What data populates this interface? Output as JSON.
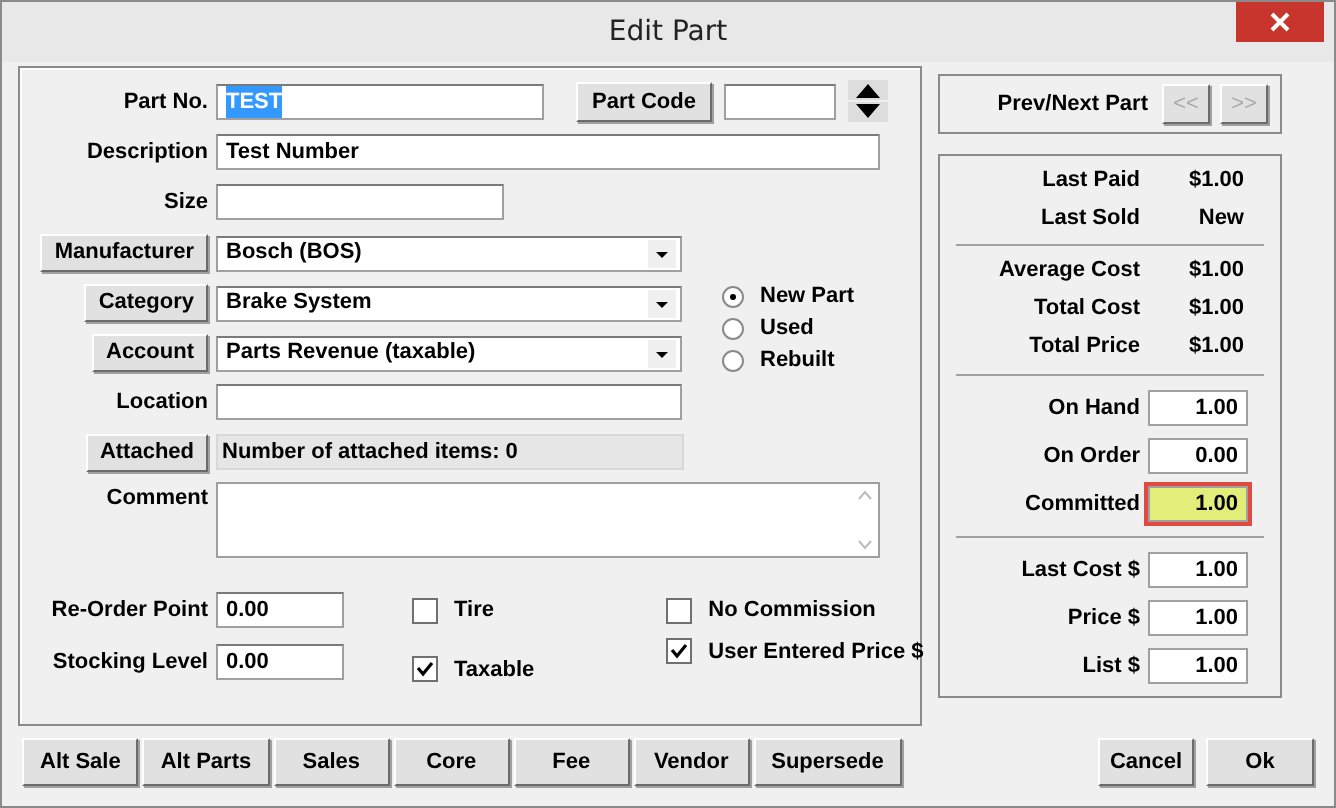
{
  "window": {
    "title": "Edit Part"
  },
  "part_no": {
    "label": "Part No.",
    "value": "TEST",
    "text_selected": true
  },
  "part_code": {
    "button": "Part Code"
  },
  "description": {
    "label": "Description",
    "value": "Test Number"
  },
  "size": {
    "label": "Size"
  },
  "dropdowns": [
    {
      "button": "Manufacturer",
      "value": "Bosch (BOS)"
    },
    {
      "button": "Category",
      "value": "Brake System"
    },
    {
      "button": "Account",
      "value": "Parts Revenue (taxable)"
    }
  ],
  "condition": [
    {
      "label": "New Part",
      "selected": true
    },
    {
      "label": "Used",
      "selected": false
    },
    {
      "label": "Rebuilt",
      "selected": false
    }
  ],
  "location": {
    "label": "Location"
  },
  "attached": {
    "button": "Attached",
    "text": "Number of attached items: 0"
  },
  "comment": {
    "label": "Comment"
  },
  "stock_fields": [
    {
      "label": "Re-Order Point",
      "value": "0.00"
    },
    {
      "label": "Stocking Level",
      "value": "0.00"
    }
  ],
  "flags_left": [
    {
      "label": "Tire",
      "checked": false
    },
    {
      "label": "Taxable",
      "checked": true
    }
  ],
  "flags_right": [
    {
      "label": "No Commission",
      "checked": false
    },
    {
      "label": "User Entered Price $",
      "checked": true
    }
  ],
  "prev_next": {
    "label": "Prev/Next Part",
    "prev": "<<",
    "next": ">>",
    "disabled": true
  },
  "history": [
    {
      "label": "Last Paid",
      "value": "$1.00"
    },
    {
      "label": "Last Sold",
      "value": "New"
    }
  ],
  "costs": [
    {
      "label": "Average Cost",
      "value": "$1.00"
    },
    {
      "label": "Total Cost",
      "value": "$1.00"
    },
    {
      "label": "Total Price",
      "value": "$1.00"
    }
  ],
  "quantities": [
    {
      "label": "On Hand",
      "value": "1.00",
      "highlighted": false
    },
    {
      "label": "On Order",
      "value": "0.00",
      "highlighted": false
    },
    {
      "label": "Committed",
      "value": "1.00",
      "highlighted": true
    }
  ],
  "prices": [
    {
      "label": "Last Cost $",
      "value": "1.00"
    },
    {
      "label": "Price $",
      "value": "1.00"
    },
    {
      "label": "List $",
      "value": "1.00"
    }
  ],
  "buttons_left": [
    "Alt Sale",
    "Alt Parts",
    "Sales",
    "Core",
    "Fee",
    "Vendor",
    "Supersede"
  ],
  "buttons_right": [
    "Cancel",
    "Ok"
  ]
}
